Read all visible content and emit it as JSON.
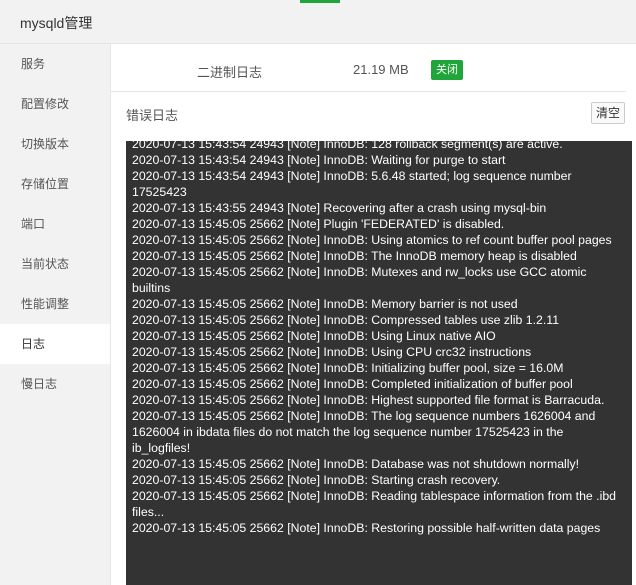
{
  "window": {
    "title": "mysqld管理"
  },
  "sidebar": {
    "items": [
      {
        "label": "服务"
      },
      {
        "label": "配置修改"
      },
      {
        "label": "切换版本"
      },
      {
        "label": "存储位置"
      },
      {
        "label": "端口"
      },
      {
        "label": "当前状态"
      },
      {
        "label": "性能调整"
      },
      {
        "label": "日志",
        "active": true
      },
      {
        "label": "慢日志"
      }
    ]
  },
  "binlog": {
    "label": "二进制日志",
    "size": "21.19 MB",
    "button": "关闭"
  },
  "errlog": {
    "title": "错误日志",
    "clear_button": "清空"
  },
  "log_lines": [
    "2020-07-13 15:43:54 24943 [Note] InnoDB: 128 rollback segment(s) are active.",
    "2020-07-13 15:43:54 24943 [Note] InnoDB: Waiting for purge to start",
    "2020-07-13 15:43:54 24943 [Note] InnoDB: 5.6.48 started; log sequence number 17525423",
    "2020-07-13 15:43:55 24943 [Note] Recovering after a crash using mysql-bin",
    "2020-07-13 15:45:05 25662 [Note] Plugin 'FEDERATED' is disabled.",
    "2020-07-13 15:45:05 25662 [Note] InnoDB: Using atomics to ref count buffer pool pages",
    "2020-07-13 15:45:05 25662 [Note] InnoDB: The InnoDB memory heap is disabled",
    "2020-07-13 15:45:05 25662 [Note] InnoDB: Mutexes and rw_locks use GCC atomic builtins",
    "2020-07-13 15:45:05 25662 [Note] InnoDB: Memory barrier is not used",
    "2020-07-13 15:45:05 25662 [Note] InnoDB: Compressed tables use zlib 1.2.11",
    "2020-07-13 15:45:05 25662 [Note] InnoDB: Using Linux native AIO",
    "2020-07-13 15:45:05 25662 [Note] InnoDB: Using CPU crc32 instructions",
    "2020-07-13 15:45:05 25662 [Note] InnoDB: Initializing buffer pool, size = 16.0M",
    "2020-07-13 15:45:05 25662 [Note] InnoDB: Completed initialization of buffer pool",
    "2020-07-13 15:45:05 25662 [Note] InnoDB: Highest supported file format is Barracuda.",
    "2020-07-13 15:45:05 25662 [Note] InnoDB: The log sequence numbers 1626004 and 1626004 in ibdata files do not match the log sequence number 17525423 in the ib_logfiles!",
    "2020-07-13 15:45:05 25662 [Note] InnoDB: Database was not shutdown normally!",
    "2020-07-13 15:45:05 25662 [Note] InnoDB: Starting crash recovery.",
    "2020-07-13 15:45:05 25662 [Note] InnoDB: Reading tablespace information from the .ibd files...",
    "2020-07-13 15:45:05 25662 [Note] InnoDB: Restoring possible half-written data pages"
  ],
  "colors": {
    "accent": "#20a53a",
    "log_bg": "#333333"
  }
}
